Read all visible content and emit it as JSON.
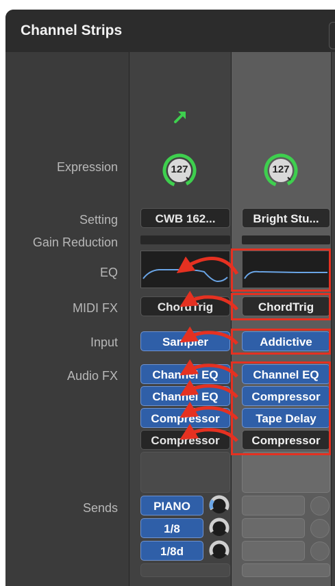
{
  "window": {
    "title": "Channel Strips"
  },
  "labels": {
    "expression": "Expression",
    "setting": "Setting",
    "gain_reduction": "Gain Reduction",
    "eq": "EQ",
    "midi_fx": "MIDI FX",
    "input": "Input",
    "audio_fx": "Audio FX",
    "sends": "Sends"
  },
  "strip1": {
    "expression_value": "127",
    "setting": "CWB 162...",
    "midi_fx": "ChordTrig",
    "input": "Sampler",
    "audio_fx": [
      "Channel EQ",
      "Channel EQ",
      "Compressor",
      "Compressor"
    ],
    "sends": [
      "PIANO",
      "1/8",
      "1/8d"
    ]
  },
  "strip2": {
    "expression_value": "127",
    "setting": "Bright Stu...",
    "midi_fx": "ChordTrig",
    "input": "Addictive",
    "audio_fx": [
      "Channel EQ",
      "Compressor",
      "Tape Delay",
      "Compressor"
    ]
  },
  "colors": {
    "highlight_red": "#e53121",
    "knob_ring_green": "#3ecf4e",
    "input_blue": "#2f5fa8"
  }
}
